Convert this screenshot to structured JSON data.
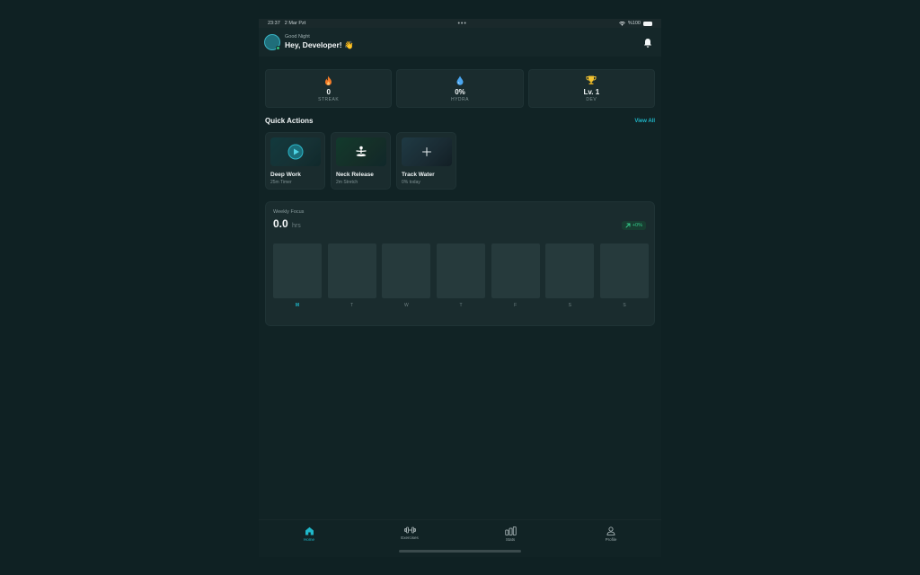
{
  "status_bar": {
    "time": "23:37",
    "date": "2 Mar Pzt",
    "dots": "•••",
    "battery": "%100"
  },
  "header": {
    "greeting_small": "Good Night",
    "greeting_main": "Hey, Developer! 👋"
  },
  "stats": [
    {
      "icon": "flame-icon",
      "value": "0",
      "label": "STREAK",
      "color": "#f47b28"
    },
    {
      "icon": "droplet-icon",
      "value": "0%",
      "label": "HYDRA",
      "color": "#4aa6f0"
    },
    {
      "icon": "trophy-icon",
      "value": "Lv. 1",
      "label": "DEV",
      "color": "#f2c230"
    }
  ],
  "quick_actions": {
    "title": "Quick Actions",
    "view_all": "View All",
    "items": [
      {
        "icon": "play-icon",
        "name": "Deep Work",
        "sub": "25m Timer"
      },
      {
        "icon": "meditation-icon",
        "name": "Neck Release",
        "sub": "2m Stretch"
      },
      {
        "icon": "plus-icon",
        "name": "Track Water",
        "sub": "0% today"
      }
    ]
  },
  "weekly_focus": {
    "label": "Weekly Focus",
    "value": "0.0",
    "unit": "hrs",
    "change": "+0%",
    "days": [
      "M",
      "T",
      "W",
      "T",
      "F",
      "S",
      "S"
    ],
    "active_day_index": 0
  },
  "tabs": [
    {
      "icon": "home-icon",
      "label": "Home",
      "active": true
    },
    {
      "icon": "dumbbell-icon",
      "label": "Exercises",
      "active": false
    },
    {
      "icon": "bar-chart-icon",
      "label": "Stats",
      "active": false
    },
    {
      "icon": "user-icon",
      "label": "Profile",
      "active": false
    }
  ],
  "colors": {
    "accent": "#1fb7c9",
    "success": "#34c98a",
    "background": "#0f2123",
    "card": "#1a2c2e"
  }
}
